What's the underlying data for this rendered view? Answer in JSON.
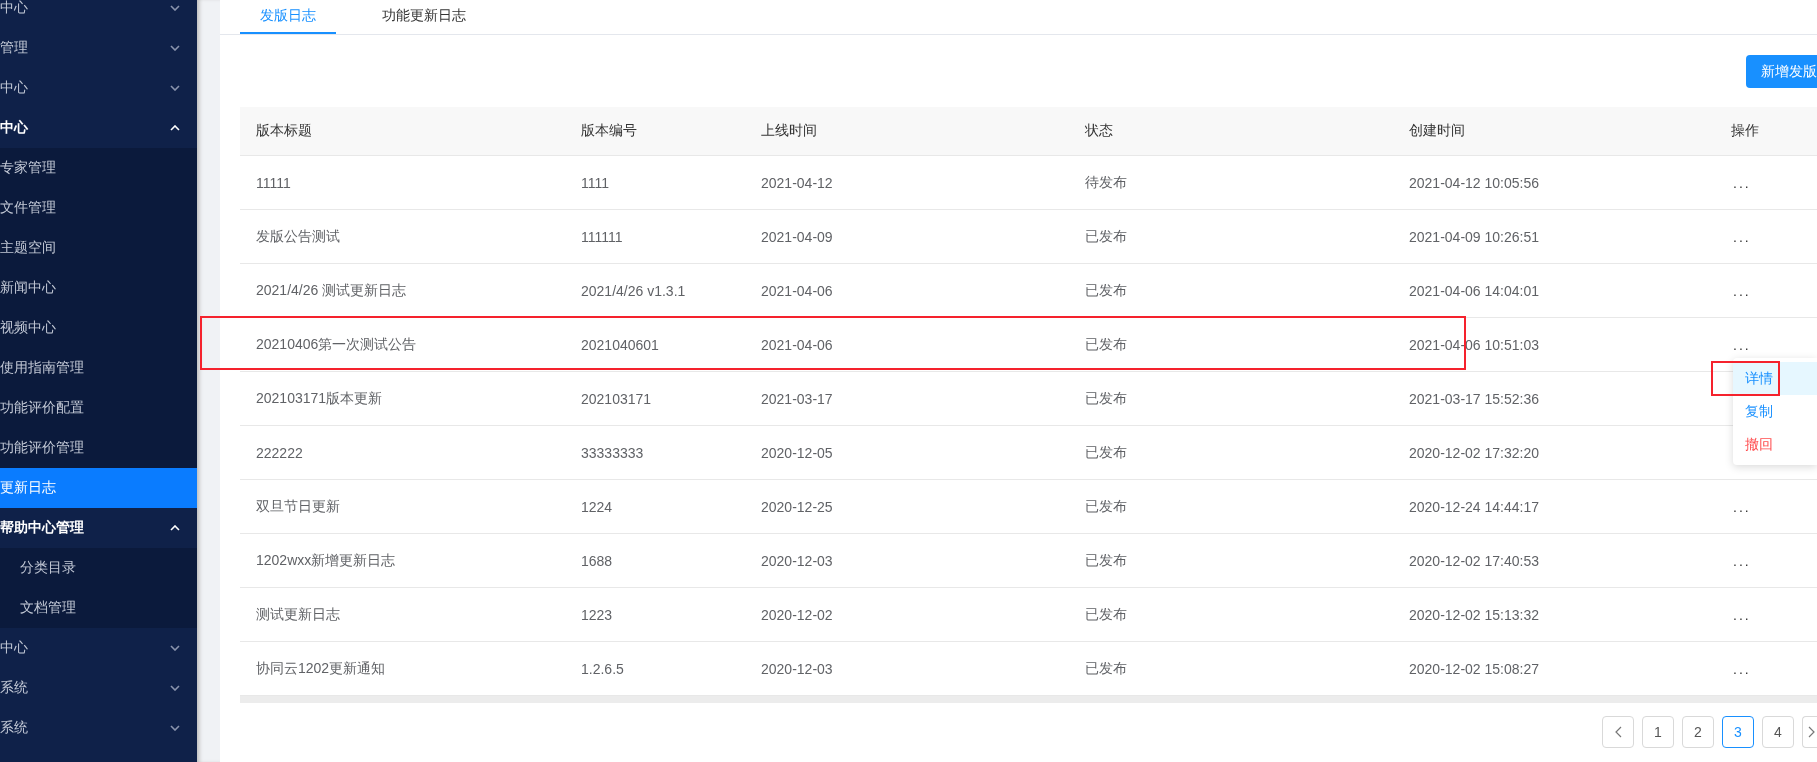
{
  "sidebar": {
    "items": [
      {
        "label": "中心",
        "expanded": false
      },
      {
        "label": "管理",
        "expanded": false
      },
      {
        "label": "中心",
        "expanded": false
      },
      {
        "label": "中心",
        "expanded": true,
        "children": [
          {
            "label": "专家管理",
            "selected": false
          },
          {
            "label": "文件管理",
            "selected": false
          },
          {
            "label": "主题空间",
            "selected": false
          },
          {
            "label": "新闻中心",
            "selected": false
          },
          {
            "label": "视频中心",
            "selected": false
          },
          {
            "label": "使用指南管理",
            "selected": false
          },
          {
            "label": "功能评价配置",
            "selected": false
          },
          {
            "label": "功能评价管理",
            "selected": false
          },
          {
            "label": "更新日志",
            "selected": true
          }
        ]
      },
      {
        "label": "帮助中心管理",
        "expanded": true,
        "children": [
          {
            "label": "分类目录",
            "selected": false
          },
          {
            "label": "文档管理",
            "selected": false
          }
        ]
      },
      {
        "label": "中心",
        "expanded": false
      },
      {
        "label": "系统",
        "expanded": false
      },
      {
        "label": "系统",
        "expanded": false
      }
    ]
  },
  "tabs": [
    {
      "label": "发版日志",
      "selected": true
    },
    {
      "label": "功能更新日志",
      "selected": false
    }
  ],
  "add_button": "新增发版",
  "table": {
    "columns": [
      "版本标题",
      "版本编号",
      "上线时间",
      "状态",
      "创建时间",
      "操作"
    ],
    "rows": [
      {
        "cells": [
          "11111",
          "1111",
          "2021-04-12",
          "待发布",
          "2021-04-12 10:05:56"
        ],
        "ops": "...",
        "highlighted": false
      },
      {
        "cells": [
          "发版公告测试",
          "111111",
          "2021-04-09",
          "已发布",
          "2021-04-09 10:26:51"
        ],
        "ops": "...",
        "highlighted": false
      },
      {
        "cells": [
          "2021/4/26 测试更新日志",
          "2021/4/26 v1.3.1",
          "2021-04-06",
          "已发布",
          "2021-04-06 14:04:01"
        ],
        "ops": "...",
        "highlighted": false
      },
      {
        "cells": [
          "20210406第一次测试公告",
          "2021040601",
          "2021-04-06",
          "已发布",
          "2021-04-06 10:51:03"
        ],
        "ops": "...",
        "highlighted": true
      },
      {
        "cells": [
          "202103171版本更新",
          "202103171",
          "2021-03-17",
          "已发布",
          "2021-03-17 15:52:36"
        ],
        "highlighted": false
      },
      {
        "cells": [
          "222222",
          "33333333",
          "2020-12-05",
          "已发布",
          "2020-12-02 17:32:20"
        ],
        "highlighted": false
      },
      {
        "cells": [
          "双旦节日更新",
          "1224",
          "2020-12-25",
          "已发布",
          "2020-12-24 14:44:17"
        ],
        "ops": "...",
        "highlighted": false
      },
      {
        "cells": [
          "1202wxx新增更新日志",
          "1688",
          "2020-12-03",
          "已发布",
          "2020-12-02 17:40:53"
        ],
        "ops": "...",
        "highlighted": false
      },
      {
        "cells": [
          "测试更新日志",
          "1223",
          "2020-12-02",
          "已发布",
          "2020-12-02 15:13:32"
        ],
        "ops": "...",
        "highlighted": false
      },
      {
        "cells": [
          "协同云1202更新通知",
          "1.2.6.5",
          "2020-12-03",
          "已发布",
          "2020-12-02 15:08:27"
        ],
        "ops": "...",
        "highlighted": false
      }
    ]
  },
  "action_menu": {
    "items": [
      {
        "label": "详情",
        "color": "#1890ff",
        "hovered": true,
        "highlighted": true
      },
      {
        "label": "复制",
        "color": "#1890ff",
        "hovered": false,
        "highlighted": false
      },
      {
        "label": "撤回",
        "color": "#ff4d4f",
        "hovered": false,
        "highlighted": false
      }
    ]
  },
  "pagination": {
    "pages": [
      {
        "label": "1",
        "selected": false
      },
      {
        "label": "2",
        "selected": false
      },
      {
        "label": "3",
        "selected": true
      },
      {
        "label": "4",
        "selected": false
      }
    ]
  }
}
